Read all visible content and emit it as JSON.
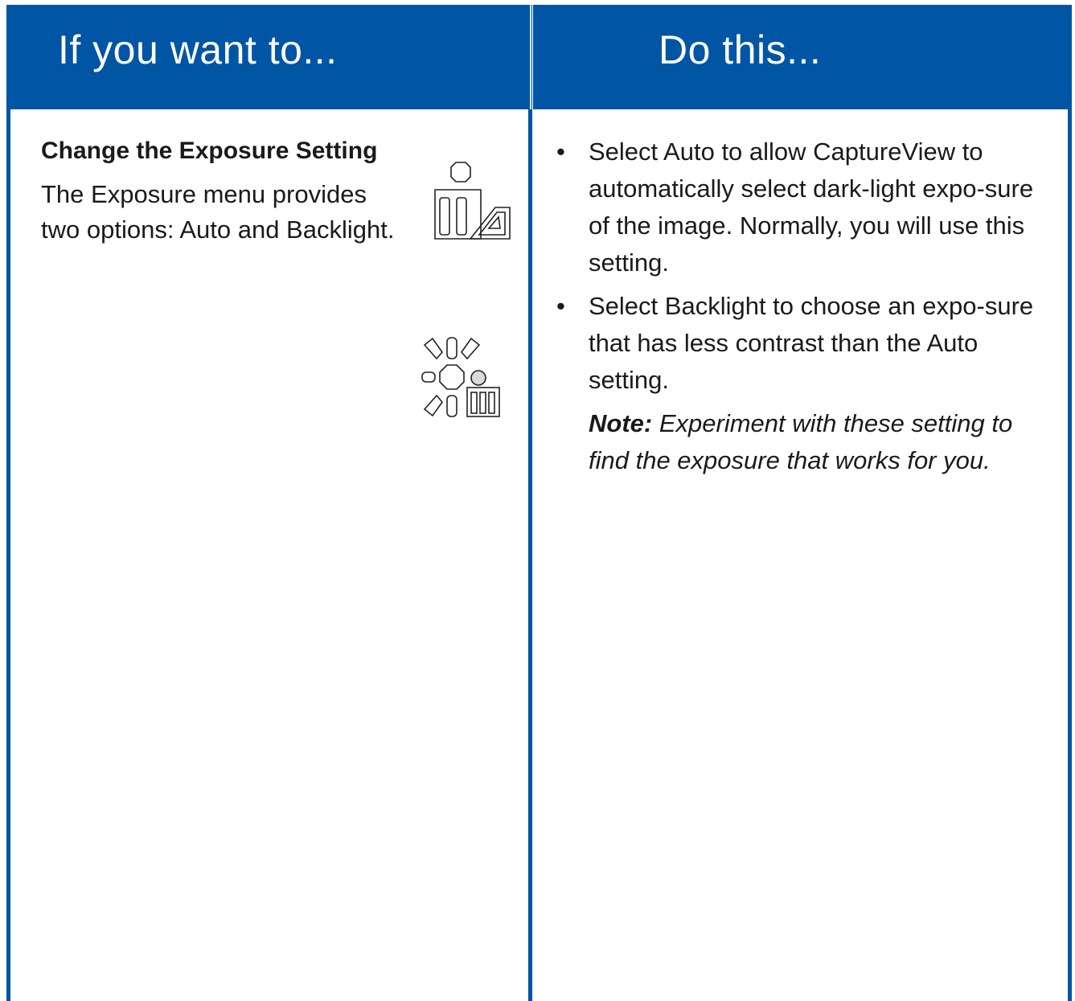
{
  "header": {
    "left_title": "If you want to...",
    "right_title": "Do this..."
  },
  "left": {
    "title": "Change the Exposure Setting",
    "body": "The Exposure menu provides two options: Auto and Backlight."
  },
  "icons": {
    "auto": "auto-exposure-icon",
    "backlight": "backlight-icon"
  },
  "right": {
    "bullets": [
      "Select Auto to allow CaptureView to automatically select dark-light expo-sure of the image. Normally, you will use this setting.",
      "Select Backlight to choose an expo-sure that has less contrast than the Auto setting."
    ],
    "note_label": "Note:",
    "note_text": " Experiment with these setting to find the exposure that works for you."
  },
  "colors": {
    "header_bg": "#0055a4",
    "header_text": "#ffffff"
  }
}
